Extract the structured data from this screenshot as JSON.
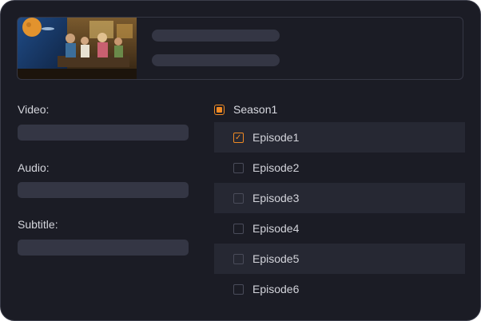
{
  "media": {
    "thumbnail_icon": "video-thumbnail"
  },
  "fields": {
    "video_label": "Video:",
    "audio_label": "Audio:",
    "subtitle_label": "Subtitle:"
  },
  "season": {
    "label": "Season1",
    "state": "partial"
  },
  "episodes": [
    {
      "label": "Episode1",
      "checked": true
    },
    {
      "label": "Episode2",
      "checked": false
    },
    {
      "label": "Episode3",
      "checked": false
    },
    {
      "label": "Episode4",
      "checked": false
    },
    {
      "label": "Episode5",
      "checked": false
    },
    {
      "label": "Episode6",
      "checked": false
    }
  ],
  "colors": {
    "background": "#1b1c25",
    "accent": "#f08a24",
    "placeholder": "#343644",
    "row_stripe": "#262833"
  }
}
